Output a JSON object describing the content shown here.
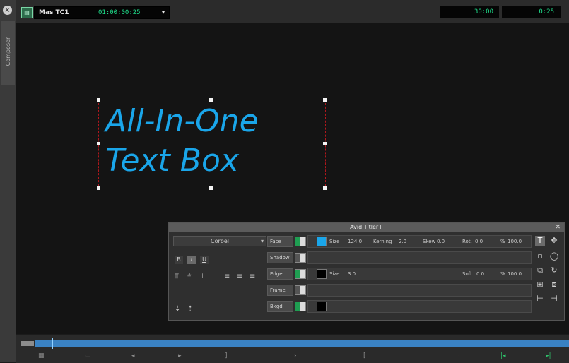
{
  "composer": {
    "side_label": "Composer",
    "timecode_name": "Mas TC1",
    "timecode_value": "01:00:00:25",
    "duration": "30:00",
    "position": "0:25"
  },
  "canvas": {
    "title_lines": [
      "All-In-One",
      "Text Box"
    ],
    "text_color": "#1aa6ea"
  },
  "titler": {
    "window_title": "Avid Titler+",
    "font": "Corbel",
    "style_buttons": [
      "B",
      "I",
      "U"
    ],
    "face": {
      "label": "Face",
      "color": "#1aa6ea",
      "size_label": "Size",
      "size_value": "124.0",
      "kerning_label": "Kerning",
      "kerning_value": "2.0",
      "skew_label": "Skew",
      "skew_value": "0.0",
      "rot_label": "Rot.",
      "rot_value": "0.0",
      "opacity_label": "%",
      "opacity_value": "100.0"
    },
    "shadow": {
      "label": "Shadow"
    },
    "edge": {
      "label": "Edge",
      "color": "#000000",
      "size_label": "Size",
      "size_value": "3.0",
      "soft_label": "Soft.",
      "soft_value": "0.0",
      "opacity_label": "%",
      "opacity_value": "100.0"
    },
    "frame": {
      "label": "Frame"
    },
    "bkgd": {
      "label": "Bkgd",
      "color": "#000000"
    }
  },
  "transport": {
    "controls": [
      "▭",
      "◂",
      "▸",
      "]",
      "›",
      "[",
      "·",
      "|◂",
      "▸|"
    ]
  }
}
